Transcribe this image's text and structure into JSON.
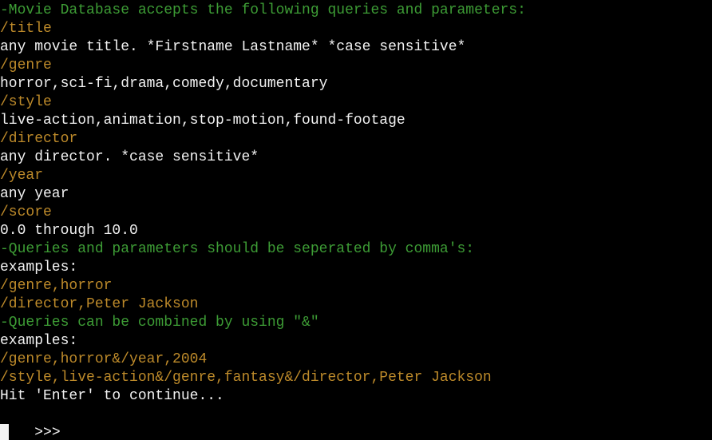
{
  "terminal": {
    "lines": [
      {
        "text": "-Movie Database accepts the following queries and parameters:",
        "kind": "info"
      },
      {
        "text": "/title",
        "kind": "query"
      },
      {
        "text": "any movie title. *Firstname Lastname* *case sensitive*",
        "kind": "value"
      },
      {
        "text": "/genre",
        "kind": "query"
      },
      {
        "text": "horror,sci-fi,drama,comedy,documentary",
        "kind": "value"
      },
      {
        "text": "/style",
        "kind": "query"
      },
      {
        "text": "live-action,animation,stop-motion,found-footage",
        "kind": "value"
      },
      {
        "text": "/director",
        "kind": "query"
      },
      {
        "text": "any director. *case sensitive*",
        "kind": "value"
      },
      {
        "text": "/year",
        "kind": "query"
      },
      {
        "text": "any year",
        "kind": "value"
      },
      {
        "text": "/score",
        "kind": "query"
      },
      {
        "text": "0.0 through 10.0",
        "kind": "value"
      },
      {
        "text": "-Queries and parameters should be seperated by comma's:",
        "kind": "info"
      },
      {
        "text": "examples:",
        "kind": "value"
      },
      {
        "text": "/genre,horror",
        "kind": "query"
      },
      {
        "text": "/director,Peter Jackson",
        "kind": "query"
      },
      {
        "text": "-Queries can be combined by using \"&\"",
        "kind": "info"
      },
      {
        "text": "examples:",
        "kind": "value"
      },
      {
        "text": "/genre,horror&/year,2004",
        "kind": "query"
      },
      {
        "text": "/style,live-action&/genre,fantasy&/director,Peter Jackson",
        "kind": "query"
      },
      {
        "text": "Hit 'Enter' to continue...",
        "kind": "value"
      }
    ],
    "prompt": ">>>",
    "colors": {
      "background": "#000000",
      "info": "#3d9c35",
      "query": "#bd8a2a",
      "value": "#f2f2f2"
    }
  }
}
